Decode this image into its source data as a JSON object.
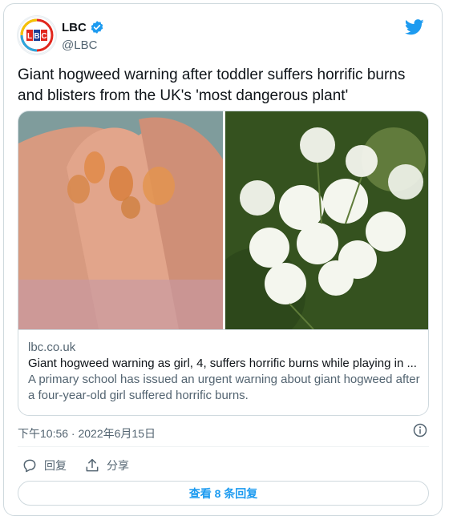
{
  "author": {
    "name": "LBC",
    "handle": "@LBC",
    "verified": true
  },
  "tweet": {
    "text": "Giant hogweed warning after toddler suffers horrific burns and blisters from the UK's 'most dangerous plant'",
    "timestamp": "下午10:56 · 2022年6月15日"
  },
  "link_card": {
    "domain": "lbc.co.uk",
    "title": "Giant hogweed warning as girl, 4, suffers horrific burns while playing in ...",
    "description": "A primary school has issued an urgent warning about giant hogweed after a four-year-old girl suffered horrific burns."
  },
  "actions": {
    "reply_label": "回复",
    "share_label": "分享"
  },
  "replies_button": "查看 8 条回复",
  "colors": {
    "twitter_blue": "#1d9bf0",
    "text_primary": "#0f1419",
    "text_secondary": "#536471",
    "border": "#cfd9de"
  },
  "icons": [
    "lbc-logo-icon",
    "verified-badge-icon",
    "twitter-bird-icon",
    "info-icon",
    "reply-icon",
    "share-icon"
  ]
}
